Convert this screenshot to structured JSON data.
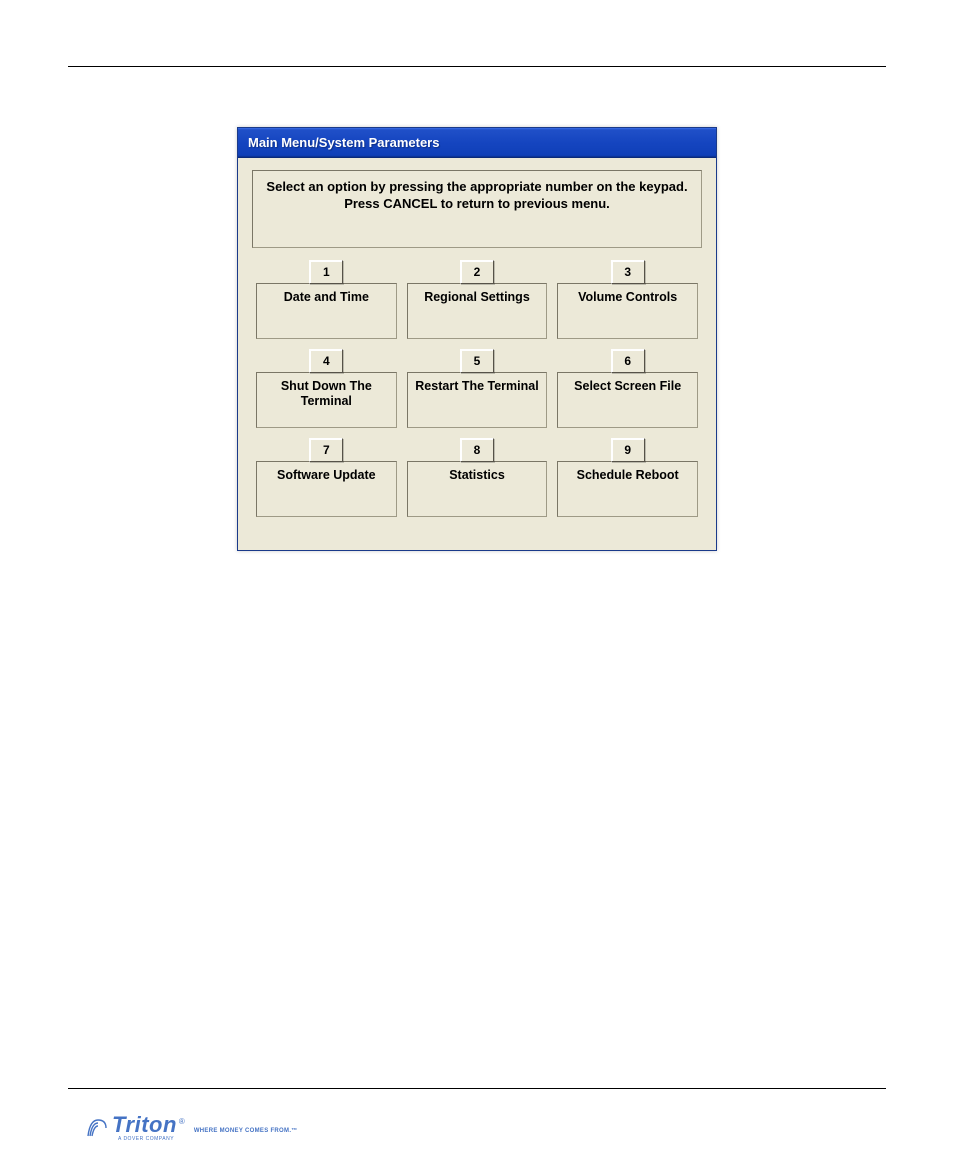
{
  "window": {
    "title": "Main Menu/System Parameters",
    "instruction_line1": "Select an option by pressing the appropriate number on the keypad.",
    "instruction_line2": "Press CANCEL to return to previous menu.",
    "options": [
      {
        "num": "1",
        "label": "Date and Time"
      },
      {
        "num": "2",
        "label": "Regional Settings"
      },
      {
        "num": "3",
        "label": "Volume Controls"
      },
      {
        "num": "4",
        "label": "Shut Down The Terminal"
      },
      {
        "num": "5",
        "label": "Restart The Terminal"
      },
      {
        "num": "6",
        "label": "Select Screen File"
      },
      {
        "num": "7",
        "label": "Software Update"
      },
      {
        "num": "8",
        "label": "Statistics"
      },
      {
        "num": "9",
        "label": "Schedule Reboot"
      }
    ]
  },
  "footer": {
    "brand": "Triton",
    "reg": "®",
    "tagline": "WHERE MONEY COMES FROM.™",
    "sub": "A DOVER COMPANY"
  }
}
